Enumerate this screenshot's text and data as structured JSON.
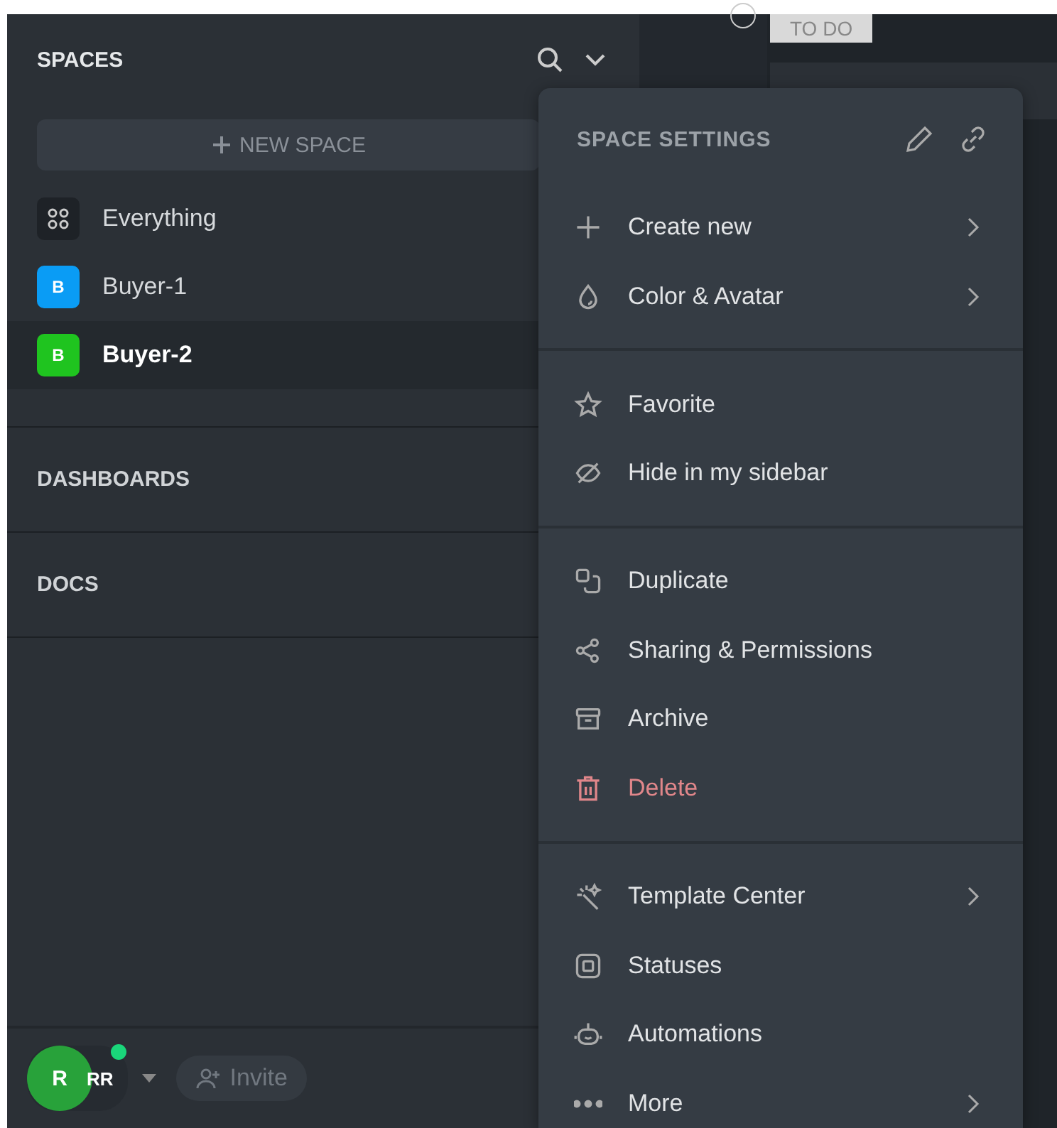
{
  "sidebar": {
    "title": "SPACES",
    "new_space": "NEW SPACE",
    "spaces": [
      {
        "name": "Everything",
        "kind": "all",
        "selected": false
      },
      {
        "name": "Buyer-1",
        "kind": "space",
        "avatar": "B",
        "color": "#0a9cf5",
        "selected": false
      },
      {
        "name": "Buyer-2",
        "kind": "space",
        "avatar": "B",
        "color": "#1fc41f",
        "selected": true
      }
    ],
    "sections": [
      "DASHBOARDS",
      "DOCS"
    ],
    "user": {
      "avatar": "R",
      "initials": "RR",
      "online": true
    },
    "invite": "Invite"
  },
  "board": {
    "column": "TO DO"
  },
  "menu": {
    "title": "SPACE SETTINGS",
    "groups": [
      [
        {
          "label": "Create new",
          "submenu": true
        },
        {
          "label": "Color & Avatar",
          "submenu": true
        }
      ],
      [
        {
          "label": "Favorite",
          "submenu": false
        },
        {
          "label": "Hide in my sidebar",
          "submenu": false
        }
      ],
      [
        {
          "label": "Duplicate",
          "submenu": false
        },
        {
          "label": "Sharing & Permissions",
          "submenu": false
        },
        {
          "label": "Archive",
          "submenu": false
        },
        {
          "label": "Delete",
          "submenu": false,
          "danger": true
        }
      ],
      [
        {
          "label": "Template Center",
          "submenu": true
        },
        {
          "label": "Statuses",
          "submenu": false
        },
        {
          "label": "Automations",
          "submenu": false
        },
        {
          "label": "More",
          "submenu": true
        }
      ]
    ]
  }
}
